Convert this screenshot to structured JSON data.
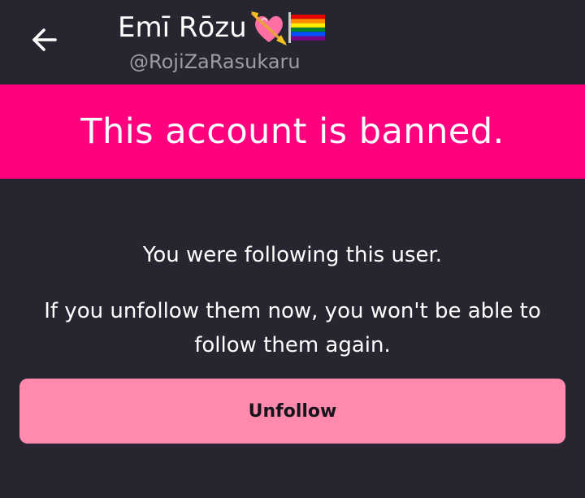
{
  "header": {
    "back_icon": "arrow-left-icon",
    "display_name": "Emī Rōzu",
    "name_emojis": [
      "heart-with-arrow-icon",
      "rainbow-flag-icon"
    ],
    "handle": "@RojiZaRasukaru"
  },
  "banner": {
    "text": "This account is banned.",
    "color": "#ff007f"
  },
  "notice": {
    "following_text": "You were following this user.",
    "warning_text": "If you unfollow them now, you won't be able to follow them again."
  },
  "actions": {
    "unfollow_label": "Unfollow",
    "unfollow_color": "#ff8aae"
  },
  "colors": {
    "background": "#272630",
    "handle_text": "#9c9ba6"
  }
}
